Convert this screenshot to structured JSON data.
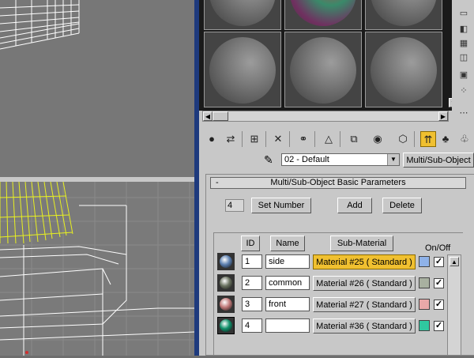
{
  "editor": {
    "material_dropdown": "02 - Default",
    "material_type_button": "Multi/Sub-Object"
  },
  "rollout": {
    "title": "Multi/Sub-Object Basic Parameters",
    "collapse_glyph": "-",
    "count": "4",
    "set_number": "Set Number",
    "add": "Add",
    "delete": "Delete",
    "headers": {
      "id": "ID",
      "name": "Name",
      "submaterial": "Sub-Material",
      "onoff": "On/Off"
    },
    "rows": [
      {
        "id": "1",
        "name": "side",
        "material": "Material #25  ( Standard )",
        "color": "#8fb2e8",
        "ball": "#5b7fb0",
        "checked": "✓",
        "selected": true
      },
      {
        "id": "2",
        "name": "common",
        "material": "Material #26  ( Standard )",
        "color": "#a8b0a0",
        "ball": "#6a7260",
        "checked": "✓",
        "selected": false
      },
      {
        "id": "3",
        "name": "front",
        "material": "Material #27  ( Standard )",
        "color": "#e8a8a8",
        "ball": "#c07878",
        "checked": "✓",
        "selected": false
      },
      {
        "id": "4",
        "name": "",
        "material": "Material #36  ( Standard )",
        "color": "#30c8a0",
        "ball": "#10906a",
        "checked": "✓",
        "selected": false
      }
    ]
  }
}
